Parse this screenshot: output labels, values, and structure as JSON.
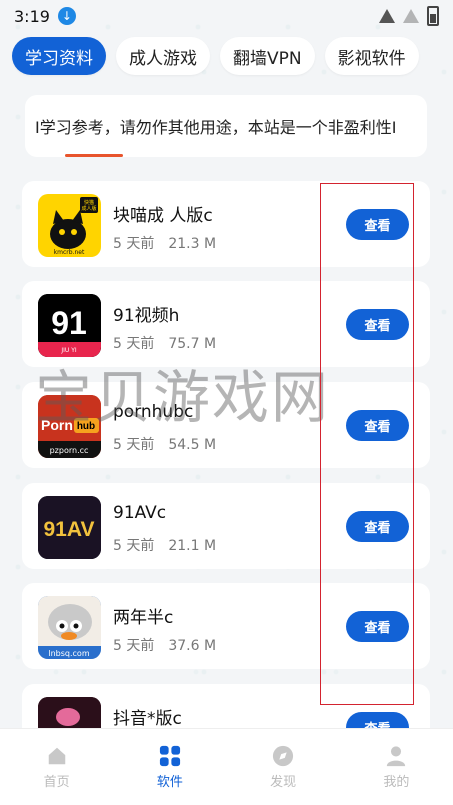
{
  "status": {
    "time": "3:19"
  },
  "tabs": [
    {
      "label": "学习资料",
      "active": true
    },
    {
      "label": "成人游戏",
      "active": false
    },
    {
      "label": "翻墙VPN",
      "active": false
    },
    {
      "label": "影视软件",
      "active": false
    }
  ],
  "notice": {
    "text": "I学习参考，请勿作其他用途，本站是一个非盈利性I"
  },
  "view_label": "查看",
  "apps": [
    {
      "name": "块喵成 人版c",
      "age": "5 天前",
      "size": "21.3 M",
      "icon": "cat-icon",
      "icon_text": "kmcrb.net",
      "badge": "快猫\n成人版"
    },
    {
      "name": "91视频h",
      "age": "5 天前",
      "size": "75.7 M",
      "icon": "91-video-icon",
      "icon_text": "91",
      "badge": "JIU YI"
    },
    {
      "name": "pornhubc",
      "age": "5 天前",
      "size": "54.5 M",
      "icon": "pornhub-icon",
      "icon_text": "Porn",
      "badge": "hub",
      "extra": "pzporn.cc"
    },
    {
      "name": "91AVc",
      "age": "5 天前",
      "size": "21.1 M",
      "icon": "91av-icon",
      "icon_text": "91AV",
      "badge": ""
    },
    {
      "name": "两年半c",
      "age": "5 天前",
      "size": "37.6 M",
      "icon": "cartoon-icon",
      "icon_text": "lnbsq.com",
      "badge": ""
    },
    {
      "name": "抖音*版c",
      "age": "",
      "size": "",
      "icon": "douyin-icon",
      "icon_text": "",
      "badge": ""
    }
  ],
  "watermark": "宝贝游戏网",
  "nav": [
    {
      "label": "首页",
      "icon": "home-icon",
      "active": false
    },
    {
      "label": "软件",
      "icon": "apps-grid-icon",
      "active": true
    },
    {
      "label": "发现",
      "icon": "compass-icon",
      "active": false
    },
    {
      "label": "我的",
      "icon": "user-icon",
      "active": false
    }
  ],
  "colors": {
    "accent": "#1262d6",
    "highlight": "#d3232f"
  }
}
